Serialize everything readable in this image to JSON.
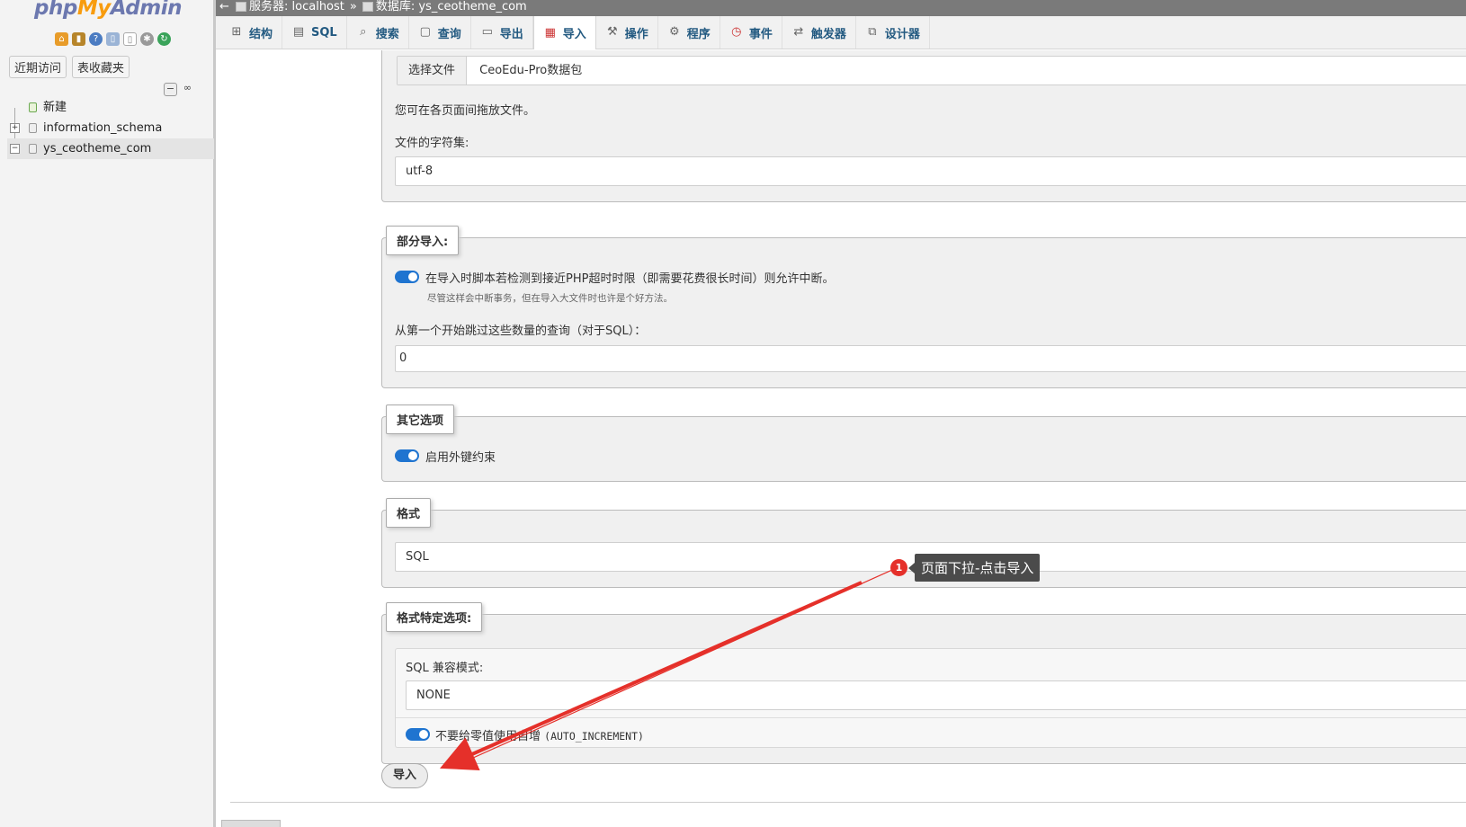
{
  "app": {
    "logo_php": "php",
    "logo_my": "My",
    "logo_admin": "Admin"
  },
  "nav": {
    "recent_label": "近期访问",
    "favorites_label": "表收藏夹",
    "tree": [
      {
        "label": "新建",
        "type": "new"
      },
      {
        "label": "information_schema",
        "type": "db"
      },
      {
        "label": "ys_ceotheme_com",
        "type": "db",
        "selected": true
      }
    ]
  },
  "breadcrumb": {
    "server_label": "服务器:",
    "server": "localhost",
    "separator": "»",
    "db_label": "数据库:",
    "db": "ys_ceotheme_com"
  },
  "tabs": [
    {
      "label": "结构",
      "icon": "structure-icon"
    },
    {
      "label": "SQL",
      "icon": "sql-icon"
    },
    {
      "label": "搜索",
      "icon": "search-icon"
    },
    {
      "label": "查询",
      "icon": "query-icon"
    },
    {
      "label": "导出",
      "icon": "export-icon"
    },
    {
      "label": "导入",
      "icon": "import-icon",
      "active": true
    },
    {
      "label": "操作",
      "icon": "wrench-icon"
    },
    {
      "label": "程序",
      "icon": "routines-icon"
    },
    {
      "label": "事件",
      "icon": "clock-icon"
    },
    {
      "label": "触发器",
      "icon": "triggers-icon"
    },
    {
      "label": "设计器",
      "icon": "designer-icon"
    }
  ],
  "file_section": {
    "choose_file_button": "选择文件",
    "file_name": "CeoEdu-Pro数据包",
    "drag_hint": "您可在各页面间拖放文件。",
    "charset_label": "文件的字符集:",
    "charset_value": "utf-8"
  },
  "partial_import": {
    "legend": "部分导入:",
    "allow_interrupt_label": "在导入时脚本若检测到接近PHP超时时限（即需要花费很长时间）则允许中断。",
    "allow_interrupt_hint": "尽管这样会中断事务，但在导入大文件时也许是个好方法。",
    "skip_label": "从第一个开始跳过这些数量的查询（对于SQL）：",
    "skip_value": "0"
  },
  "other_options": {
    "legend": "其它选项",
    "fk_label": "启用外键约束"
  },
  "format": {
    "legend": "格式",
    "value": "SQL"
  },
  "format_specific": {
    "legend": "格式特定选项:",
    "compat_label": "SQL 兼容模式:",
    "compat_value": "NONE",
    "no_auto_value_label": "不要给零值使用自增",
    "no_auto_value_code": "(AUTO_INCREMENT)"
  },
  "import_button": "导入",
  "annotation": {
    "number": "1",
    "text": "页面下拉-点击导入",
    "color": "#e5302a"
  }
}
